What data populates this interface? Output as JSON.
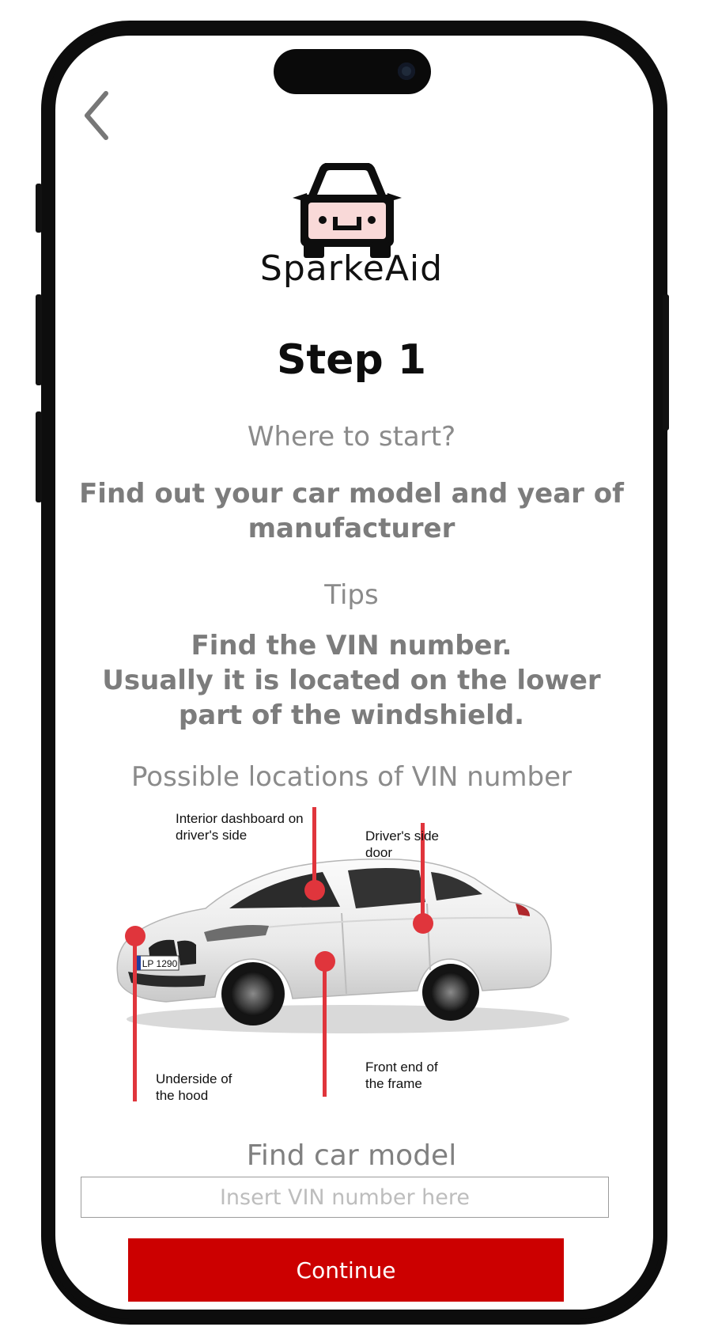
{
  "header": {
    "back_icon": "chevron-left-icon"
  },
  "logo": {
    "icon": "car-face-icon",
    "brand_text": "SparkeAid"
  },
  "step": {
    "title": "Step 1"
  },
  "intro": {
    "question": "Where to start?",
    "instruction": "Find out your car model and year of manufacturer"
  },
  "tips": {
    "heading": "Tips",
    "text_lines": [
      "Find the VIN number.",
      "Usually it is located on the lower",
      "part of the windshield."
    ]
  },
  "locations": {
    "heading": "Possible locations of VIN number",
    "callouts": {
      "dashboard": "Interior dashboard on\ndriver's side",
      "door": "Driver's side\ndoor",
      "hood": "Underside of\nthe hood",
      "frame": "Front end of\nthe frame"
    },
    "plate_text": "LP 1290"
  },
  "find_model": {
    "heading": "Find car model",
    "vin_placeholder": "Insert VIN number here",
    "vin_value": ""
  },
  "actions": {
    "continue_label": "Continue"
  },
  "colors": {
    "accent": "#cc0000",
    "marker": "#e0353c",
    "logo_face": "#f9d9d8",
    "text_gray": "#8b8b8b"
  }
}
